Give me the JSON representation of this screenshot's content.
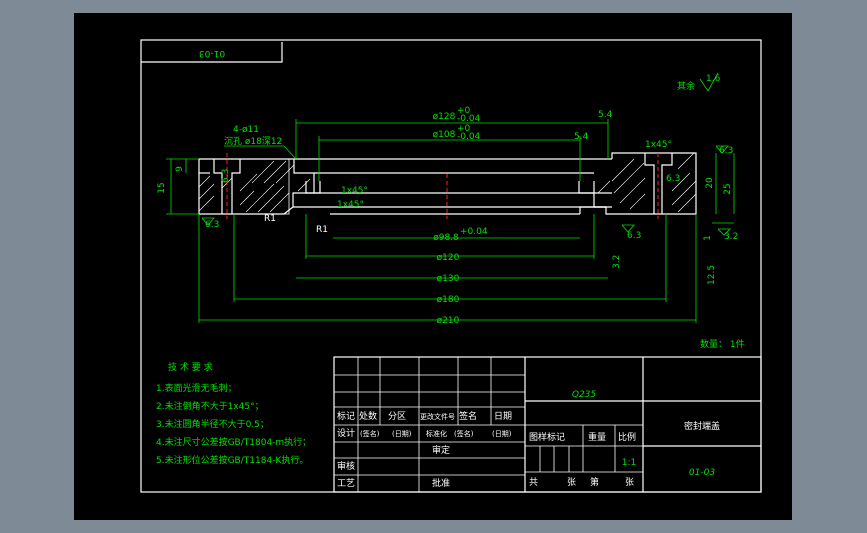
{
  "drawing": {
    "part_number_box": "01-03",
    "roughness_note": "其余",
    "roughness_value": "1.6",
    "dimensions": {
      "d128": "ø128",
      "d108": "ø108",
      "tol_upper": "+0",
      "tol_lower": "-0.04",
      "d98": "ø98.8",
      "d98_tol": "+0.04",
      "d120": "ø120",
      "d130": "ø130",
      "d180": "ø180",
      "d210": "ø210",
      "holes": "4-ø11",
      "counterbore": "沉孔 ø18深12",
      "w54a": "5.4",
      "w54b": "5.4",
      "chamfer_top": "1x45°",
      "chamfer_a": "1x45°",
      "chamfer_b": "1x45°",
      "r1a": "R1",
      "r1b": "R1",
      "h15": "15",
      "h9": "9",
      "h20": "20",
      "h25": "25",
      "h1": "1",
      "r63a": "6.3",
      "r63b": "6.3",
      "r63c": "6.3",
      "r63d": "6.3",
      "r63e": "6.3",
      "r32a": "3.2",
      "r32b": "3.2",
      "r125": "12.5"
    },
    "quantity": "数量： 1件"
  },
  "notes": {
    "heading": "技 术 要 求",
    "items": [
      "1.表面光滑无毛刺；",
      "2.未注倒角不大于1x45°；",
      "3.未注圆角半径不大于0.5；",
      "4.未注尺寸公差按GB/T1804-m执行；",
      "5.未注形位公差按GB/T1184-K执行。"
    ]
  },
  "title_block": {
    "material": "Q235",
    "part_name": "密封端盖",
    "drawing_no": "01-03",
    "scale": "1:1",
    "labels": {
      "biaoji": "标记",
      "chushu": "处数",
      "fenqu": "分区",
      "wenjian": "更改文件号",
      "qianming": "签名",
      "riqi": "日期",
      "sheji": "设计",
      "qianming2": "(签名)",
      "riqi2": "(日期)",
      "biaozhunhua": "标准化",
      "qianming3": "(签名)",
      "riqi3": "(日期)",
      "tuyang": "图样标记",
      "zhongliang": "重量",
      "bili": "比例",
      "shenhe": "审核",
      "gongyi": "工艺",
      "pizhun": "批准",
      "zhuguan": "审定",
      "gong": "共",
      "zhang1": "张",
      "di": "第",
      "zhang2": "张"
    }
  }
}
